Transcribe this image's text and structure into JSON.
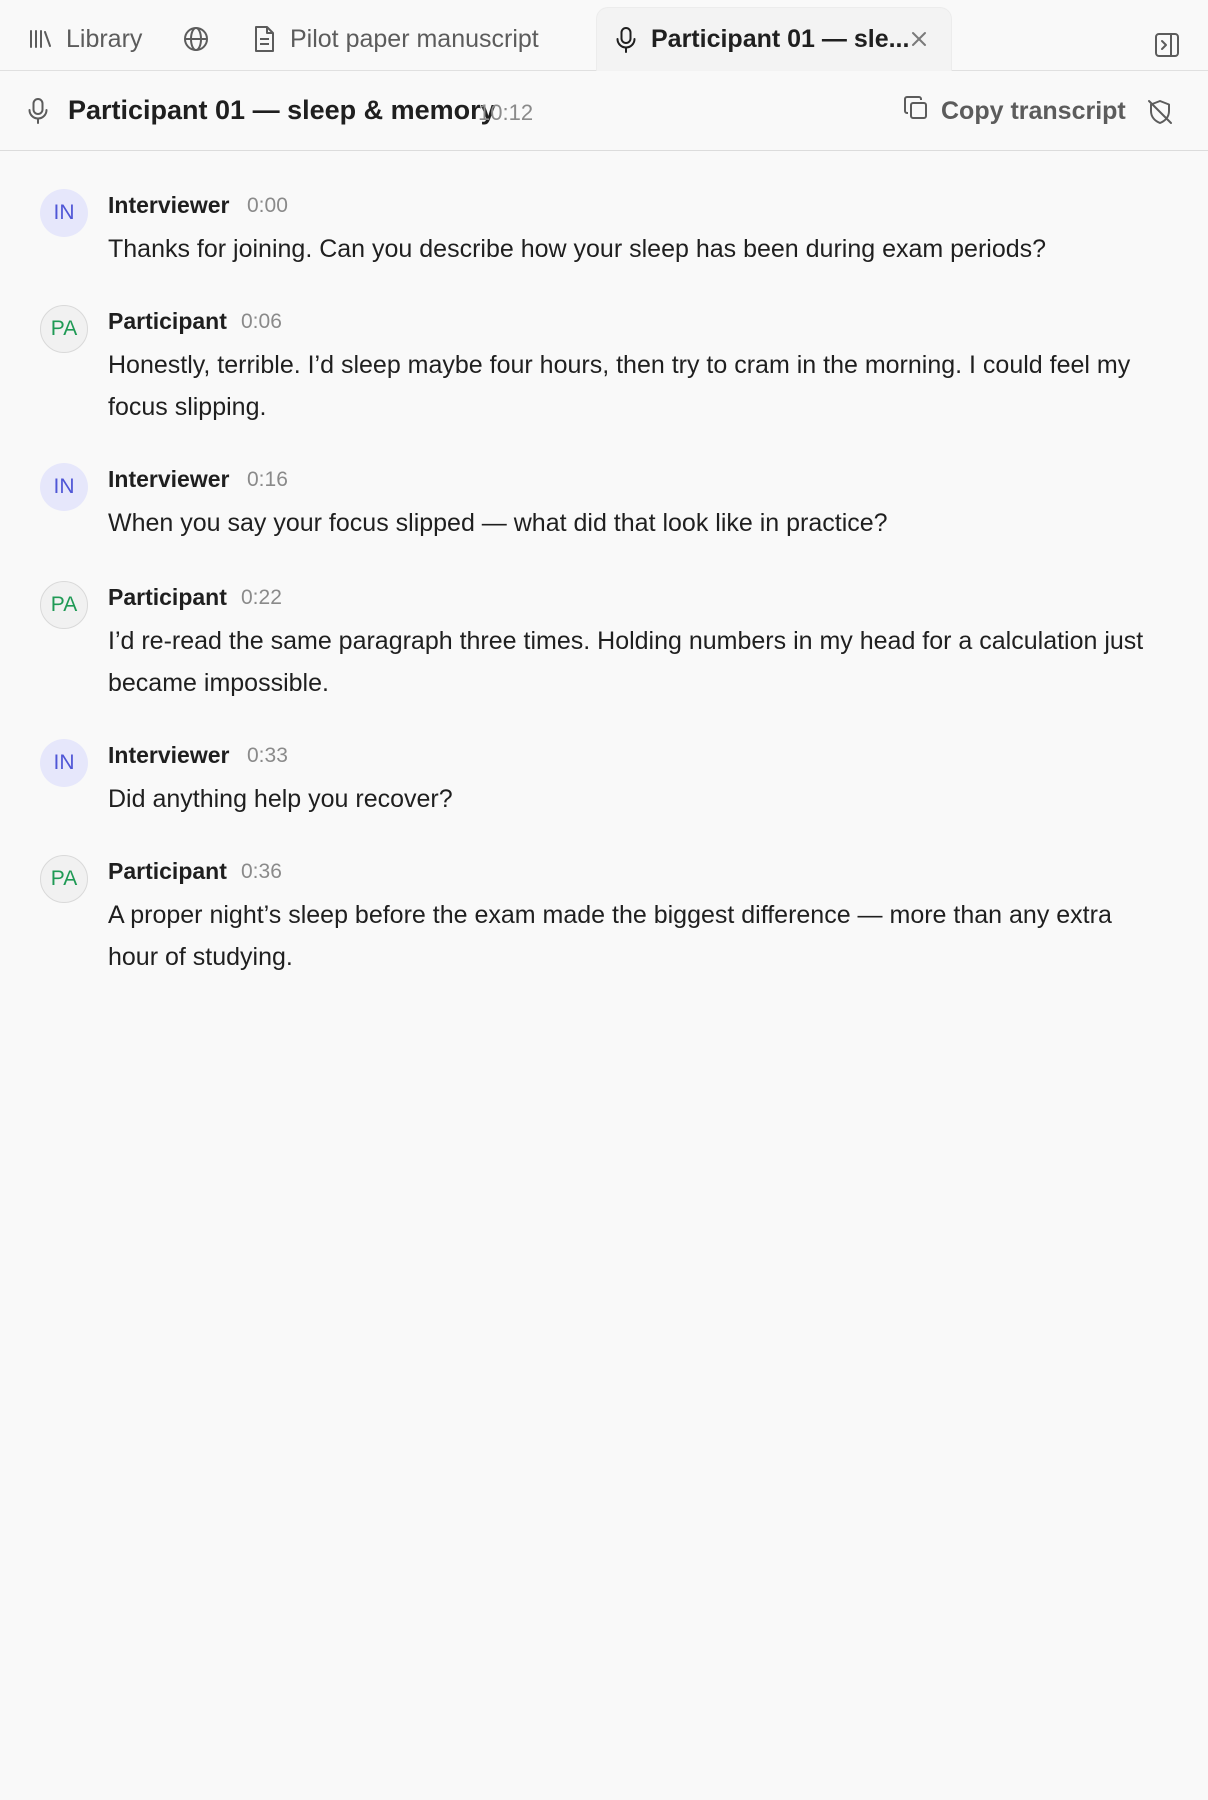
{
  "tabs": {
    "library_label": "Library",
    "web_icon": "globe-icon",
    "paper_label": "Pilot paper manuscript",
    "active_label": "Participant 01 — sle...",
    "close_icon": "close-icon"
  },
  "header": {
    "title": "Participant 01 — sleep & memory",
    "duration": "10:12",
    "copy_label": "Copy transcript"
  },
  "transcript": [
    {
      "initials": "IN",
      "speaker": "Interviewer",
      "time": "0:00",
      "text": "Thanks for joining. Can you describe how your sleep has been during exam periods?"
    },
    {
      "initials": "PA",
      "speaker": "Participant",
      "time": "0:06",
      "text": "Honestly, terrible. I’d sleep maybe four hours, then try to cram in the morning. I could feel my focus slipping."
    },
    {
      "initials": "IN",
      "speaker": "Interviewer",
      "time": "0:16",
      "text": "When you say your focus slipped — what did that look like in practice?"
    },
    {
      "initials": "PA",
      "speaker": "Participant",
      "time": "0:22",
      "text": "I’d re-read the same paragraph three times. Holding numbers in my head for a calculation just became impossible."
    },
    {
      "initials": "IN",
      "speaker": "Interviewer",
      "time": "0:33",
      "text": "Did anything help you recover?"
    },
    {
      "initials": "PA",
      "speaker": "Participant",
      "time": "0:36",
      "text": "A proper night’s sleep before the exam made the biggest difference — more than any extra hour of studying."
    }
  ],
  "colors": {
    "interviewer_accent": "#4f56d6",
    "participant_accent": "#1f9a55"
  }
}
